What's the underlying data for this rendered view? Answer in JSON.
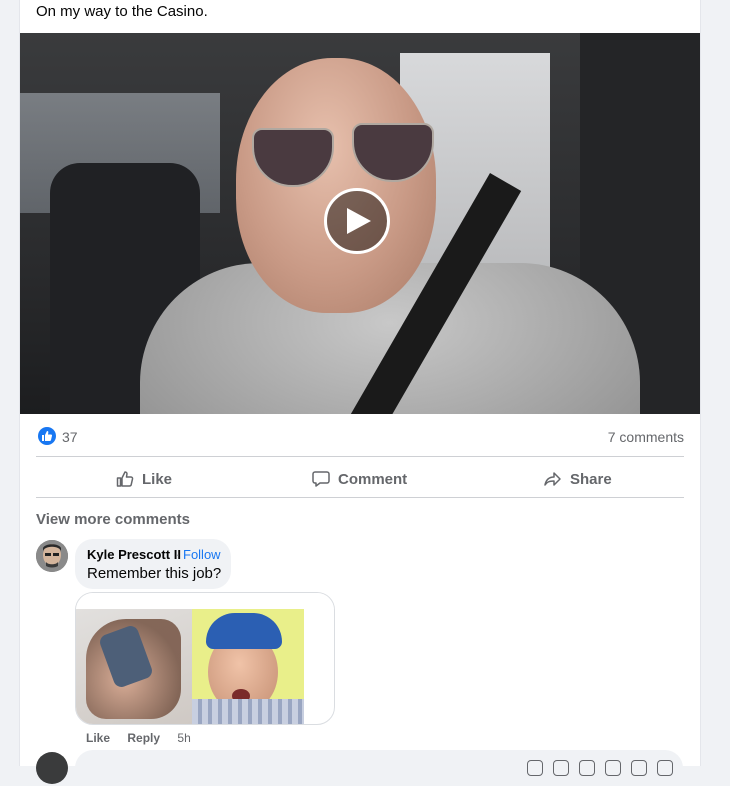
{
  "post": {
    "text": "On my way to the Casino."
  },
  "video": {
    "play_label": "Play"
  },
  "reactions": {
    "count": "37",
    "comments_label": "7 comments"
  },
  "actions": {
    "like": "Like",
    "comment": "Comment",
    "share": "Share"
  },
  "comments": {
    "view_more": "View more comments",
    "items": [
      {
        "author": "Kyle Prescott II",
        "separator": "·",
        "follow": "Follow",
        "text": "Remember this job?",
        "like": "Like",
        "reply": "Reply",
        "time": "5h"
      }
    ]
  },
  "colors": {
    "accent": "#1877f2",
    "muted": "#65676b",
    "bubble": "#f0f2f5"
  }
}
